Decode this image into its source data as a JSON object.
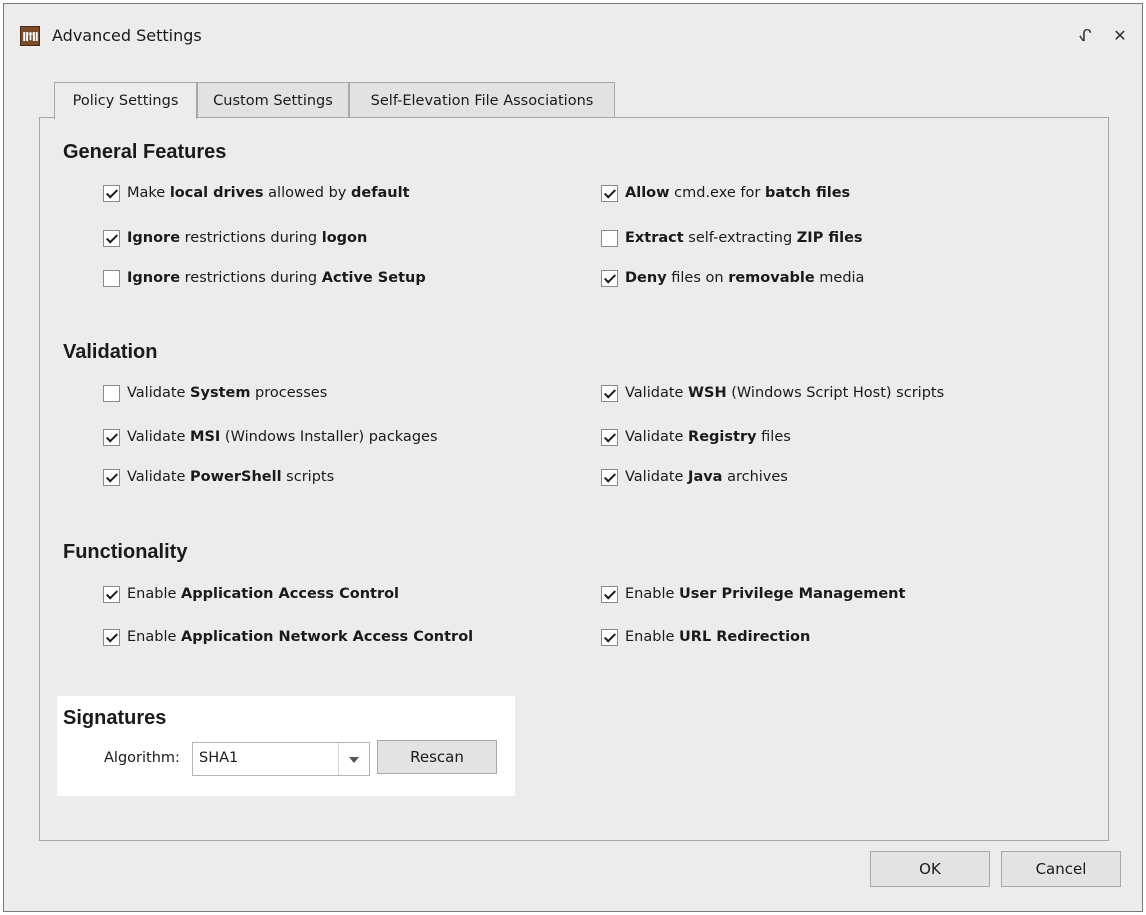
{
  "window": {
    "title": "Advanced Settings",
    "app_icon_text": "ǁ†ǁ",
    "pin_icon": "pin-icon",
    "close_icon": "close-icon",
    "pin_glyph": "ᖋ",
    "close_glyph": "✕"
  },
  "tabs": [
    {
      "label": "Policy Settings",
      "active": true
    },
    {
      "label": "Custom Settings",
      "active": false
    },
    {
      "label": "Self-Elevation File Associations",
      "active": false
    }
  ],
  "sections": {
    "general": {
      "title": "General Features",
      "items": [
        {
          "checked": true,
          "parts": [
            [
              "Make ",
              false
            ],
            [
              "local drives",
              true
            ],
            [
              " allowed by ",
              false
            ],
            [
              "default",
              true
            ]
          ]
        },
        {
          "checked": true,
          "parts": [
            [
              "Ignore",
              true
            ],
            [
              " restrictions during ",
              false
            ],
            [
              "logon",
              true
            ]
          ]
        },
        {
          "checked": false,
          "parts": [
            [
              "Ignore",
              true
            ],
            [
              " restrictions during ",
              false
            ],
            [
              "Active Setup",
              true
            ]
          ]
        },
        {
          "checked": true,
          "parts": [
            [
              "Allow",
              true
            ],
            [
              " cmd.exe for ",
              false
            ],
            [
              "batch files",
              true
            ]
          ]
        },
        {
          "checked": false,
          "parts": [
            [
              "Extract",
              true
            ],
            [
              " self-extracting ",
              false
            ],
            [
              "ZIP files",
              true
            ]
          ]
        },
        {
          "checked": true,
          "parts": [
            [
              "Deny",
              true
            ],
            [
              " files on ",
              false
            ],
            [
              "removable",
              true
            ],
            [
              " media",
              false
            ]
          ]
        }
      ]
    },
    "validation": {
      "title": "Validation",
      "items": [
        {
          "checked": false,
          "parts": [
            [
              "Validate ",
              false
            ],
            [
              "System",
              true
            ],
            [
              " processes",
              false
            ]
          ]
        },
        {
          "checked": true,
          "parts": [
            [
              "Validate ",
              false
            ],
            [
              "MSI",
              true
            ],
            [
              " (Windows Installer) packages",
              false
            ]
          ]
        },
        {
          "checked": true,
          "parts": [
            [
              "Validate ",
              false
            ],
            [
              "PowerShell",
              true
            ],
            [
              " scripts",
              false
            ]
          ]
        },
        {
          "checked": true,
          "parts": [
            [
              "Validate ",
              false
            ],
            [
              "WSH",
              true
            ],
            [
              " (Windows Script Host) scripts",
              false
            ]
          ]
        },
        {
          "checked": true,
          "parts": [
            [
              "Validate ",
              false
            ],
            [
              "Registry",
              true
            ],
            [
              " files",
              false
            ]
          ]
        },
        {
          "checked": true,
          "parts": [
            [
              "Validate ",
              false
            ],
            [
              "Java",
              true
            ],
            [
              " archives",
              false
            ]
          ]
        }
      ]
    },
    "functionality": {
      "title": "Functionality",
      "items": [
        {
          "checked": true,
          "parts": [
            [
              "Enable ",
              false
            ],
            [
              "Application Access Control",
              true
            ]
          ]
        },
        {
          "checked": true,
          "parts": [
            [
              "Enable ",
              false
            ],
            [
              "Application Network Access Control",
              true
            ]
          ]
        },
        {
          "checked": true,
          "parts": [
            [
              "Enable ",
              false
            ],
            [
              "User Privilege Management",
              true
            ]
          ]
        },
        {
          "checked": true,
          "parts": [
            [
              "Enable ",
              false
            ],
            [
              "URL Redirection",
              true
            ]
          ]
        }
      ]
    }
  },
  "signatures": {
    "title": "Signatures",
    "algorithm_label": "Algorithm:",
    "algorithm_value": "SHA1",
    "rescan_label": "Rescan"
  },
  "footer": {
    "ok_label": "OK",
    "cancel_label": "Cancel"
  }
}
